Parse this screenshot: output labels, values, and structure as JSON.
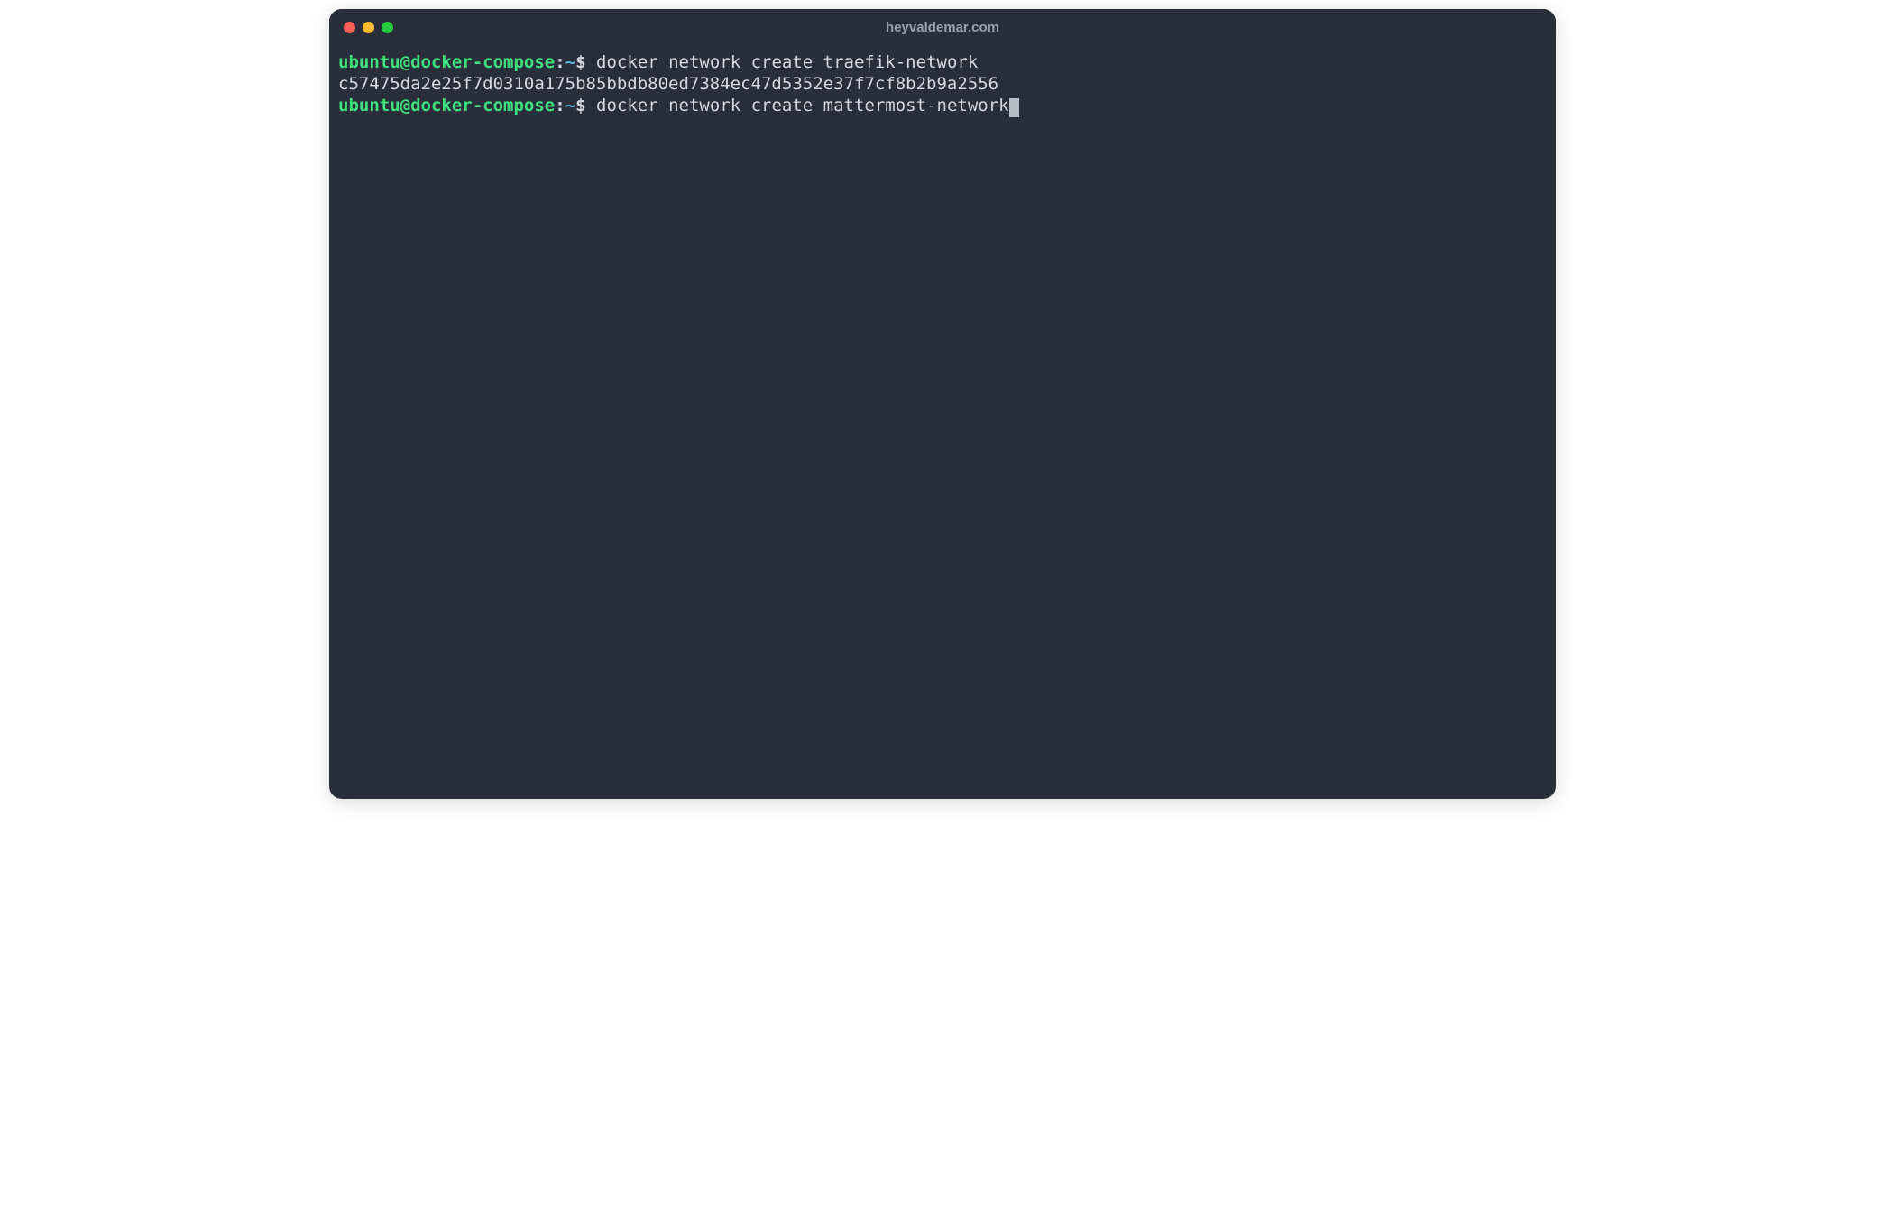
{
  "titlebar": {
    "title": "heyvaldemar.com"
  },
  "prompt": {
    "user_host": "ubuntu@docker-compose",
    "colon": ":",
    "path": "~",
    "symbol": "$"
  },
  "lines": [
    {
      "type": "cmd",
      "command": " docker network create traefik-network"
    },
    {
      "type": "output",
      "text": "c57475da2e25f7d0310a175b85bbdb80ed7384ec47d5352e37f7cf8b2b9a2556"
    },
    {
      "type": "cmd",
      "command": " docker network create mattermost-network",
      "cursor": true
    }
  ]
}
